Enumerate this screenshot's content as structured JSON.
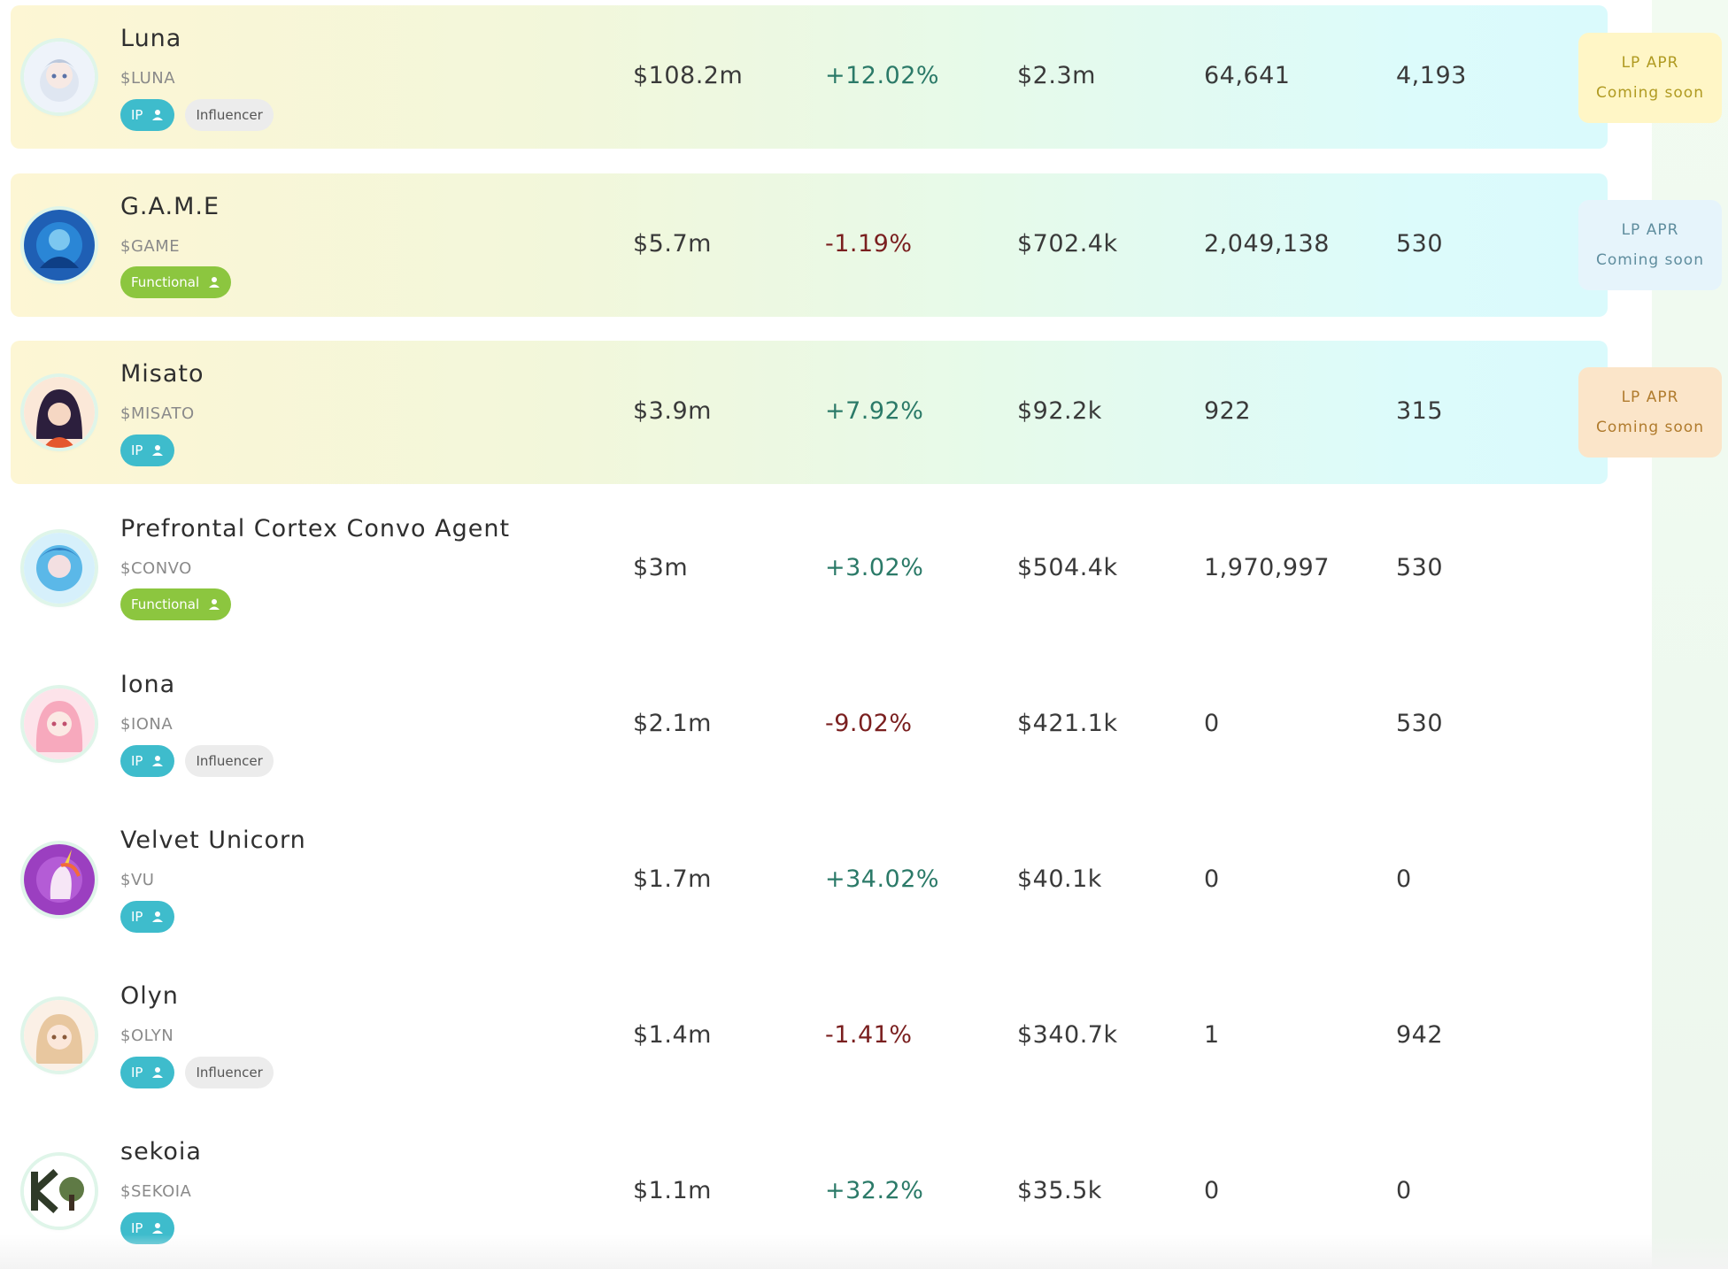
{
  "rows": [
    {
      "name": "Luna",
      "ticker": "$LUNA",
      "tags": [
        "IP",
        "Influencer"
      ],
      "market_cap": "$108.2m",
      "change": "+12.02%",
      "volume": "$2.3m",
      "holders": "64,641",
      "count": "4,193",
      "lp": {
        "label": "LP APR",
        "status": "Coming soon"
      }
    },
    {
      "name": "G.A.M.E",
      "ticker": "$GAME",
      "tags": [
        "Functional"
      ],
      "market_cap": "$5.7m",
      "change": "-1.19%",
      "volume": "$702.4k",
      "holders": "2,049,138",
      "count": "530",
      "lp": {
        "label": "LP APR",
        "status": "Coming soon"
      }
    },
    {
      "name": "Misato",
      "ticker": "$MISATO",
      "tags": [
        "IP"
      ],
      "market_cap": "$3.9m",
      "change": "+7.92%",
      "volume": "$92.2k",
      "holders": "922",
      "count": "315",
      "lp": {
        "label": "LP APR",
        "status": "Coming soon"
      }
    },
    {
      "name": "Prefrontal Cortex Convo Agent",
      "ticker": "$CONVO",
      "tags": [
        "Functional"
      ],
      "market_cap": "$3m",
      "change": "+3.02%",
      "volume": "$504.4k",
      "holders": "1,970,997",
      "count": "530"
    },
    {
      "name": "Iona",
      "ticker": "$IONA",
      "tags": [
        "IP",
        "Influencer"
      ],
      "market_cap": "$2.1m",
      "change": "-9.02%",
      "volume": "$421.1k",
      "holders": "0",
      "count": "530"
    },
    {
      "name": "Velvet Unicorn",
      "ticker": "$VU",
      "tags": [
        "IP"
      ],
      "market_cap": "$1.7m",
      "change": "+34.02%",
      "volume": "$40.1k",
      "holders": "0",
      "count": "0"
    },
    {
      "name": "Olyn",
      "ticker": "$OLYN",
      "tags": [
        "IP",
        "Influencer"
      ],
      "market_cap": "$1.4m",
      "change": "-1.41%",
      "volume": "$340.7k",
      "holders": "1",
      "count": "942"
    },
    {
      "name": "sekoia",
      "ticker": "$SEKOIA",
      "tags": [
        "IP"
      ],
      "market_cap": "$1.1m",
      "change": "+32.2%",
      "volume": "$35.5k",
      "holders": "0",
      "count": "0"
    }
  ],
  "tag_icon": "person-icon",
  "colors": {
    "ip_tag": "#3ebccc",
    "functional_tag": "#8cc63f",
    "influencer_tag": "#ececec",
    "positive_change": "#2b7a68",
    "negative_change": "#7a1f1f",
    "lp_yellow": "#fff6c6",
    "lp_blue": "#e6f4fb",
    "lp_orange": "#fbe5c9"
  }
}
